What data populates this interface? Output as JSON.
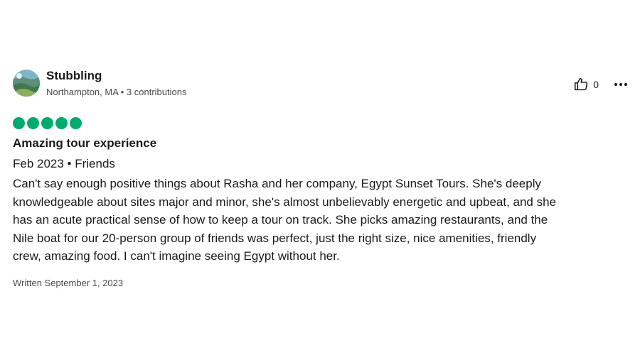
{
  "review": {
    "user": {
      "name": "Stubbling",
      "meta": "Northampton, MA • 3 contributions",
      "avatar_icon": "landscape-avatar"
    },
    "likes": {
      "count": "0",
      "icon": "thumbs-up-icon"
    },
    "more_icon": "more-options-icon",
    "rating": {
      "value": 5,
      "max": 5,
      "color": "#00aa6c"
    },
    "title": "Amazing tour experience",
    "trip": "Feb 2023 • Friends",
    "body_lines": [
      "Can't say enough positive things about Rasha and her company, Egypt Sunset Tours. She's deeply",
      "knowledgeable about sites major and minor, she's almost unbelievably energetic and upbeat, and she",
      "has an acute practical sense of how to keep a tour on track. She picks amazing restaurants, and the",
      "Nile boat for our 20-person group of friends was perfect, just the right size, nice amenities, friendly",
      "crew, amazing food. I can't imagine seeing Egypt without her."
    ],
    "written": "Written September 1, 2023"
  }
}
